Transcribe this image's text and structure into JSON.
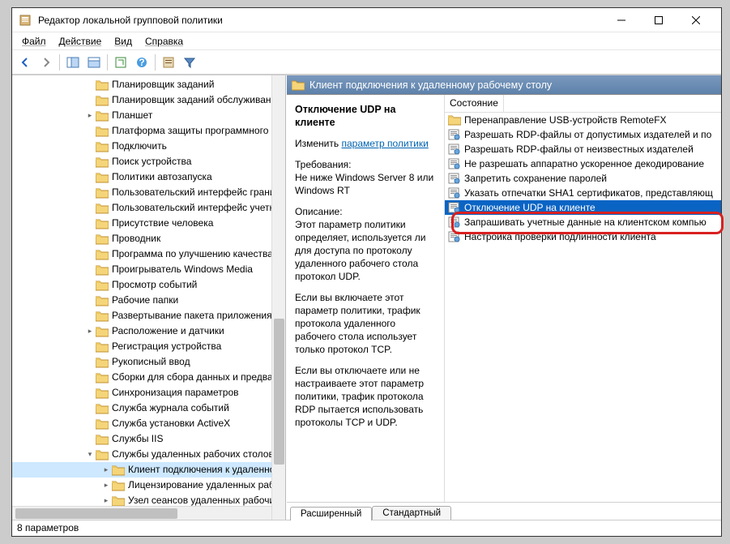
{
  "window": {
    "title": "Редактор локальной групповой политики"
  },
  "menu": {
    "file": "Файл",
    "action": "Действие",
    "view": "Вид",
    "help": "Справка"
  },
  "tree": [
    {
      "exp": "",
      "label": "Планировщик заданий"
    },
    {
      "exp": "",
      "label": "Планировщик заданий обслуживания"
    },
    {
      "exp": ">",
      "label": "Планшет"
    },
    {
      "exp": "",
      "label": "Платформа защиты программного об"
    },
    {
      "exp": "",
      "label": "Подключить"
    },
    {
      "exp": "",
      "label": "Поиск устройства"
    },
    {
      "exp": "",
      "label": "Политики автозапуска"
    },
    {
      "exp": "",
      "label": "Пользовательский интерфейс границ"
    },
    {
      "exp": "",
      "label": "Пользовательский интерфейс учетнь"
    },
    {
      "exp": "",
      "label": "Присутствие человека"
    },
    {
      "exp": "",
      "label": "Проводник"
    },
    {
      "exp": "",
      "label": "Программа по улучшению качества п"
    },
    {
      "exp": "",
      "label": "Проигрыватель Windows Media"
    },
    {
      "exp": "",
      "label": "Просмотр событий"
    },
    {
      "exp": "",
      "label": "Рабочие папки"
    },
    {
      "exp": "",
      "label": "Развертывание пакета приложения"
    },
    {
      "exp": ">",
      "label": "Расположение и датчики"
    },
    {
      "exp": "",
      "label": "Регистрация устройства"
    },
    {
      "exp": "",
      "label": "Рукописный ввод"
    },
    {
      "exp": "",
      "label": "Сборки для сбора данных и предвари"
    },
    {
      "exp": "",
      "label": "Синхронизация параметров"
    },
    {
      "exp": "",
      "label": "Служба журнала событий"
    },
    {
      "exp": "",
      "label": "Служба установки ActiveX"
    },
    {
      "exp": "",
      "label": "Службы IIS"
    },
    {
      "exp": "v",
      "label": "Службы удаленных рабочих столов"
    },
    {
      "exp": ">",
      "label": "Клиент подключения к удаленном",
      "d": 1,
      "sel": true
    },
    {
      "exp": ">",
      "label": "Лицензирование удаленных рабо",
      "d": 1
    },
    {
      "exp": ">",
      "label": "Узел сеансов удаленных рабочих",
      "d": 1
    }
  ],
  "rightHeader": "Клиент подключения к удаленному рабочему столу",
  "detail": {
    "title": "Отключение UDP на клиенте",
    "editPrefix": "Изменить ",
    "editLink": "параметр политики",
    "reqLabel": "Требования:",
    "reqText": "Не ниже Windows Server 8 или Windows RT",
    "descLabel": "Описание:",
    "p1": "Этот параметр политики определяет, используется ли для доступа по протоколу удаленного рабочего стола протокол UDP.",
    "p2": "Если вы включаете этот параметр политики, трафик протокола удаленного рабочего стола использует только протокол TCP.",
    "p3": "Если вы отключаете или не настраиваете этот параметр политики, трафик протокола RDP пытается использовать протоколы TCP и UDP."
  },
  "listHead": {
    "state": "Состояние"
  },
  "list": [
    {
      "icon": "folder",
      "label": "Перенаправление USB-устройств RemoteFX"
    },
    {
      "icon": "setting",
      "label": "Разрешать RDP-файлы от допустимых издателей и по"
    },
    {
      "icon": "setting",
      "label": "Разрешать RDP-файлы от неизвестных издателей"
    },
    {
      "icon": "setting",
      "label": "Не разрешать аппаратно ускоренное декодирование"
    },
    {
      "icon": "setting",
      "label": "Запретить сохранение паролей"
    },
    {
      "icon": "setting",
      "label": "Указать отпечатки SHA1 сертификатов, представляющ"
    },
    {
      "icon": "setting",
      "label": "Отключение UDP на клиенте",
      "sel": true
    },
    {
      "icon": "setting",
      "label": "Запрашивать учетные данные на клиентском компью"
    },
    {
      "icon": "setting",
      "label": "Настройка проверки подлинности клиента"
    }
  ],
  "tabs": {
    "extended": "Расширенный",
    "standard": "Стандартный"
  },
  "status": "8 параметров"
}
